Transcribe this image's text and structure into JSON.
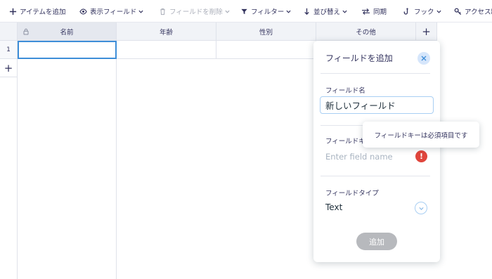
{
  "toolbar": {
    "add_item": "アイテムを追加",
    "show_fields": "表示フィールド",
    "delete_field": "フィールドを削除",
    "filter": "フィルター",
    "sort": "並び替え",
    "sync": "同期",
    "hooks": "フック",
    "access": "アクセス制"
  },
  "grid": {
    "columns": [
      "名前",
      "年齢",
      "性別",
      "その他"
    ],
    "add_column": "+",
    "rows": [
      "1"
    ],
    "add_row": "+"
  },
  "panel": {
    "title": "フィールドを追加",
    "field_name_label": "フィールド名",
    "field_name_value": "新しいフィールド",
    "field_key_label": "フィールドキー",
    "field_key_placeholder": "Enter field name",
    "error_mark": "!",
    "field_type_label": "フィールドタイプ",
    "field_type_value": "Text",
    "add_button": "追加"
  },
  "tooltip": {
    "text": "フィールドキーは必須項目です"
  },
  "colors": {
    "selection_border": "#3e8ed8",
    "error": "#e0453c",
    "add_button_disabled": "#b7b9bd",
    "close_button_bg": "#d6e6fb"
  }
}
